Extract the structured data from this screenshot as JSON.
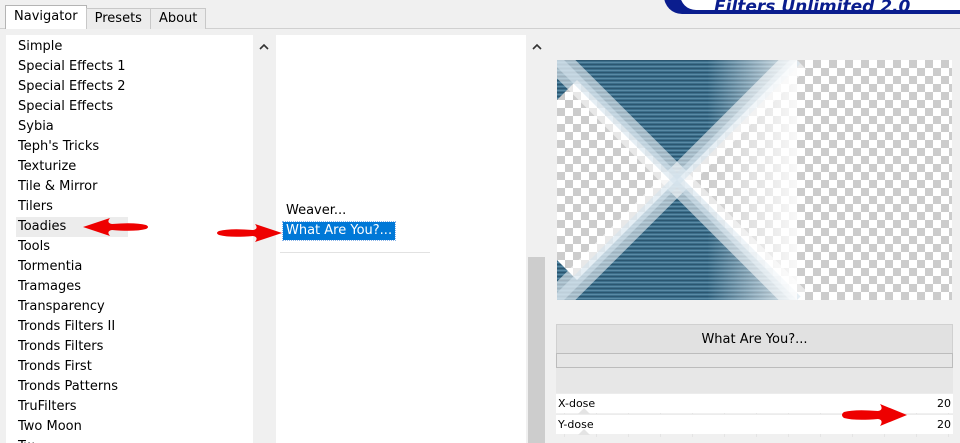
{
  "tabs": [
    {
      "label": "Navigator",
      "active": true
    },
    {
      "label": "Presets",
      "active": false
    },
    {
      "label": "About",
      "active": false
    }
  ],
  "app": {
    "title": "Filters Unlimited 2.0"
  },
  "categories": {
    "items": [
      "Simple",
      "Special Effects 1",
      "Special Effects 2",
      "Special Effects",
      "Sybia",
      "Teph's Tricks",
      "Texturize",
      "Tile & Mirror",
      "Tilers",
      "Toadies",
      "Tools",
      "Tormentia",
      "Tramages",
      "Transparency",
      "Tronds Filters II",
      "Tronds Filters",
      "Tronds First",
      "Tronds Patterns",
      "TruFilters",
      "Two Moon",
      "Tw..."
    ],
    "selected": "Toadies"
  },
  "filters": {
    "items": [
      "Weaver...",
      "What Are You?..."
    ],
    "selected": "What Are You?..."
  },
  "selected_filter_name": "What Are You?...",
  "progress": {
    "value": 0
  },
  "sliders": [
    {
      "label": "X-dose",
      "value": "20"
    },
    {
      "label": "Y-dose",
      "value": "20"
    }
  ],
  "colors": {
    "accent": "#0078d7",
    "brand": "#0a1d8e",
    "annotation": "#ee0000",
    "preview_teal": "#3c6e8a"
  }
}
